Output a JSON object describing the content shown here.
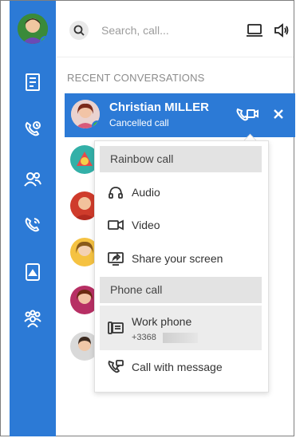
{
  "search": {
    "placeholder": "Search, call..."
  },
  "sections": {
    "recent_title": "RECENT CONVERSATIONS"
  },
  "active_conversation": {
    "name": "Christian MILLER",
    "status": "Cancelled call"
  },
  "menu": {
    "rainbow_header": "Rainbow call",
    "audio": "Audio",
    "video": "Video",
    "share": "Share your screen",
    "phone_header": "Phone call",
    "work_phone": "Work phone",
    "work_phone_number": "+3368",
    "call_with_message": "Call with message"
  },
  "colors": {
    "brand": "#2c7ad6",
    "presence": "#38c12e",
    "menu_header_bg": "#e3e3e3"
  },
  "icons": {
    "rail": [
      "user-avatar",
      "news-icon",
      "call-history-icon",
      "contacts-icon",
      "phone-icon",
      "voicemail-icon",
      "teams-icon"
    ],
    "top": [
      "search-icon",
      "laptop-icon",
      "speaker-icon"
    ]
  }
}
